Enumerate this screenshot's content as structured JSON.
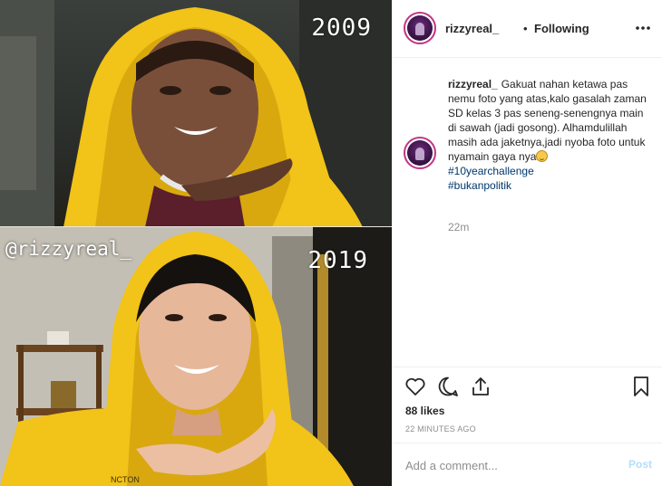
{
  "photo": {
    "top_year": "2009",
    "bottom_year": "2019",
    "watermark": "@rizzyreal_"
  },
  "header": {
    "username": "rizzyreal_",
    "separator": "•",
    "follow_status": "Following",
    "more_icon": "more-horizontal-icon"
  },
  "caption": {
    "username": "rizzyreal_",
    "text": "Gakuat nahan ketawa pas nemu foto yang atas,kalo gasalah zaman SD kelas 3 pas seneng-senengnya main di sawah (jadi gosong). Alhamdulillah masih ada jaketnya,jadi nyoba foto untuk nyamain gaya nya",
    "emoji": "grinning-emoji",
    "hashtags": [
      "#10yearchallenge",
      "#bukanpolitik"
    ],
    "time": "22m"
  },
  "actions": {
    "icons": [
      "heart-icon",
      "comment-icon",
      "share-icon",
      "bookmark-icon"
    ],
    "likes": "88 likes",
    "time_ago": "22 MINUTES AGO"
  },
  "comment_box": {
    "placeholder": "Add a comment...",
    "post_label": "Post"
  },
  "colors": {
    "link": "#00376b",
    "muted": "#8e8e8e",
    "post_disabled": "#b2dffc",
    "avatar_ring": "#c13584",
    "jacket_yellow": "#f2c318"
  }
}
